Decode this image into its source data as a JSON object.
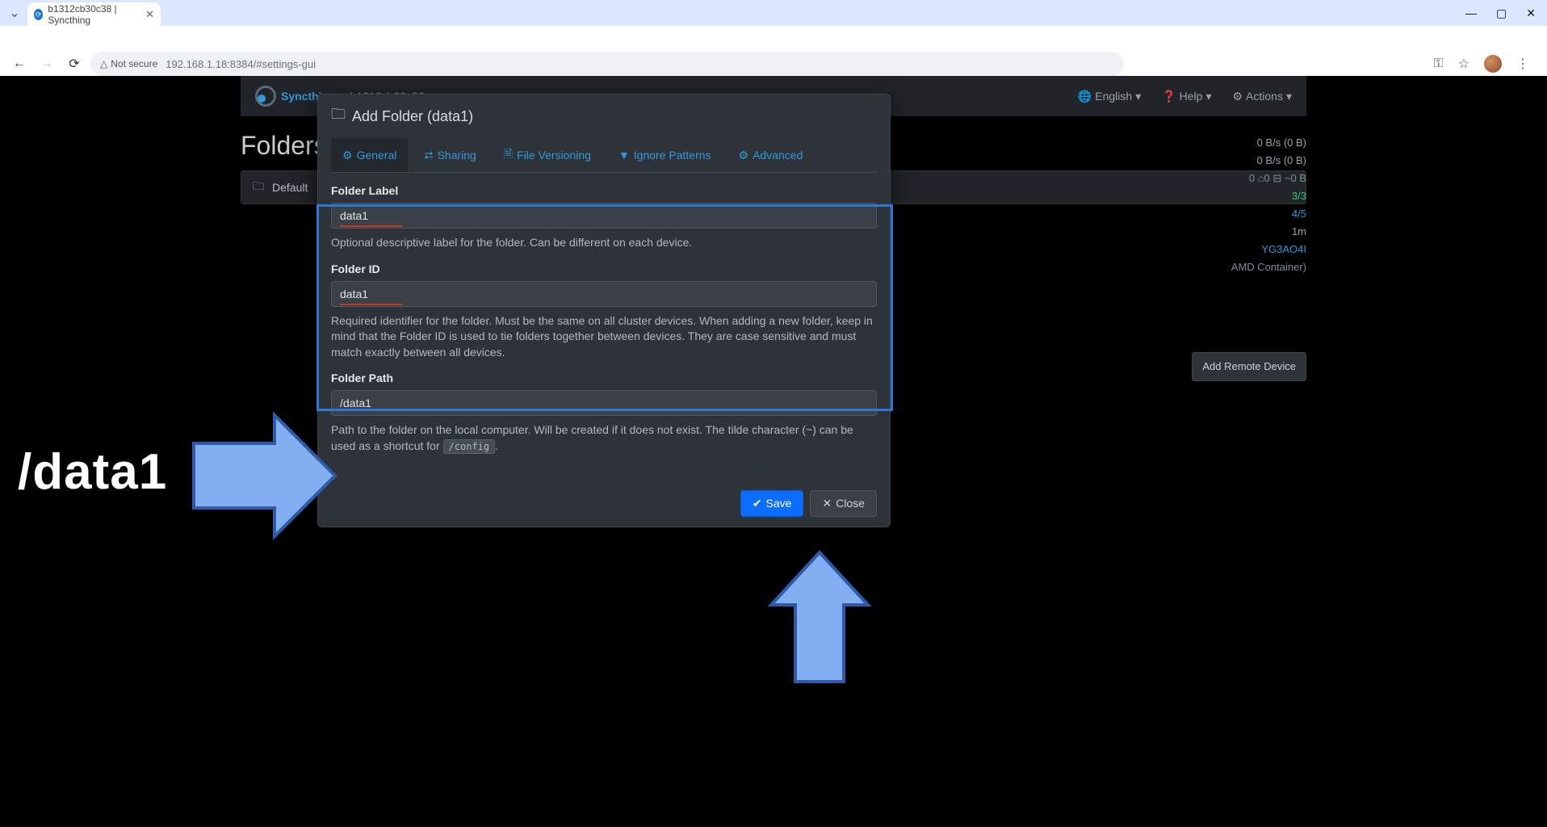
{
  "browser": {
    "tab_title": "b1312cb30c38 | Syncthing",
    "not_secure": "Not secure",
    "url": "192.168.1.18:8384/#settings-gui"
  },
  "navbar": {
    "brand": "Syncthing",
    "host": "b1312cb30c38",
    "english": "English",
    "help": "Help",
    "actions": "Actions"
  },
  "folders": {
    "title": "Folders",
    "default_label": "Default"
  },
  "side": {
    "dl": "0 B/s (0 B)",
    "ul": "0 B/s (0 B)",
    "local": "0  ⌂0  ⊟ ~0 B",
    "listeners": "3/3",
    "discovery": "4/5",
    "uptime": "1m",
    "id": "YG3AO4I",
    "container": "AMD Container)",
    "remote_btn": "Add Remote Device"
  },
  "modal": {
    "title": "Add Folder (data1)",
    "tabs": {
      "general": "General",
      "sharing": "Sharing",
      "file_versioning": "File Versioning",
      "ignore_patterns": "Ignore Patterns",
      "advanced": "Advanced"
    },
    "label_field": {
      "label": "Folder Label",
      "value": "data1",
      "help": "Optional descriptive label for the folder. Can be different on each device."
    },
    "id_field": {
      "label": "Folder ID",
      "value": "data1",
      "help": "Required identifier for the folder. Must be the same on all cluster devices. When adding a new folder, keep in mind that the Folder ID is used to tie folders together between devices. They are case sensitive and must match exactly between all devices."
    },
    "path_field": {
      "label": "Folder Path",
      "value": "/data1",
      "help_pre": "Path to the folder on the local computer. Will be created if it does not exist. The tilde character (~) can be used as a shortcut for ",
      "help_code": "/config",
      "help_post": "."
    },
    "save": "Save",
    "close": "Close"
  },
  "annotation": {
    "text": "/data1"
  }
}
